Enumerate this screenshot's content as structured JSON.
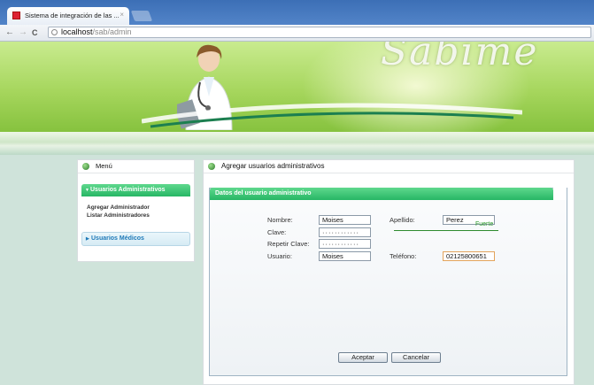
{
  "browser": {
    "tab_title": "Sistema de integración de las ...",
    "tab_close": "×",
    "url_host": "localhost",
    "url_path": "/sab/admin",
    "nav": {
      "back": "←",
      "forward": "→",
      "reload": "C"
    }
  },
  "banner": {
    "logo_text": "Sabime"
  },
  "sidebar": {
    "title": "Menú",
    "sections": [
      {
        "label": "Usuarios Administrativos",
        "expanded": true,
        "items": [
          "Agregar Administrador",
          "Listar Administradores"
        ]
      },
      {
        "label": "Usuarios Médicos",
        "expanded": false
      }
    ]
  },
  "main": {
    "title": "Agregar usuarios administrativos",
    "form": {
      "tab_label": "Datos del usuario administrativo",
      "nombre": {
        "label": "Nombre:",
        "value": "Moises"
      },
      "apellido": {
        "label": "Apellido:",
        "value": "Perez"
      },
      "clave": {
        "label": "Clave:",
        "value": "············"
      },
      "strength": "Fuerte",
      "repetir_clave": {
        "label": "Repetir Clave:",
        "value": "············"
      },
      "usuario": {
        "label": "Usuario:",
        "value": "Moises"
      },
      "telefono": {
        "label": "Teléfono:",
        "value": "02125800651"
      },
      "accept_label": "Aceptar",
      "cancel_label": "Cancelar"
    }
  },
  "colors": {
    "accent_green": "#27b665",
    "link_blue": "#1f7ab8",
    "strength_green": "#2a9a2a"
  }
}
